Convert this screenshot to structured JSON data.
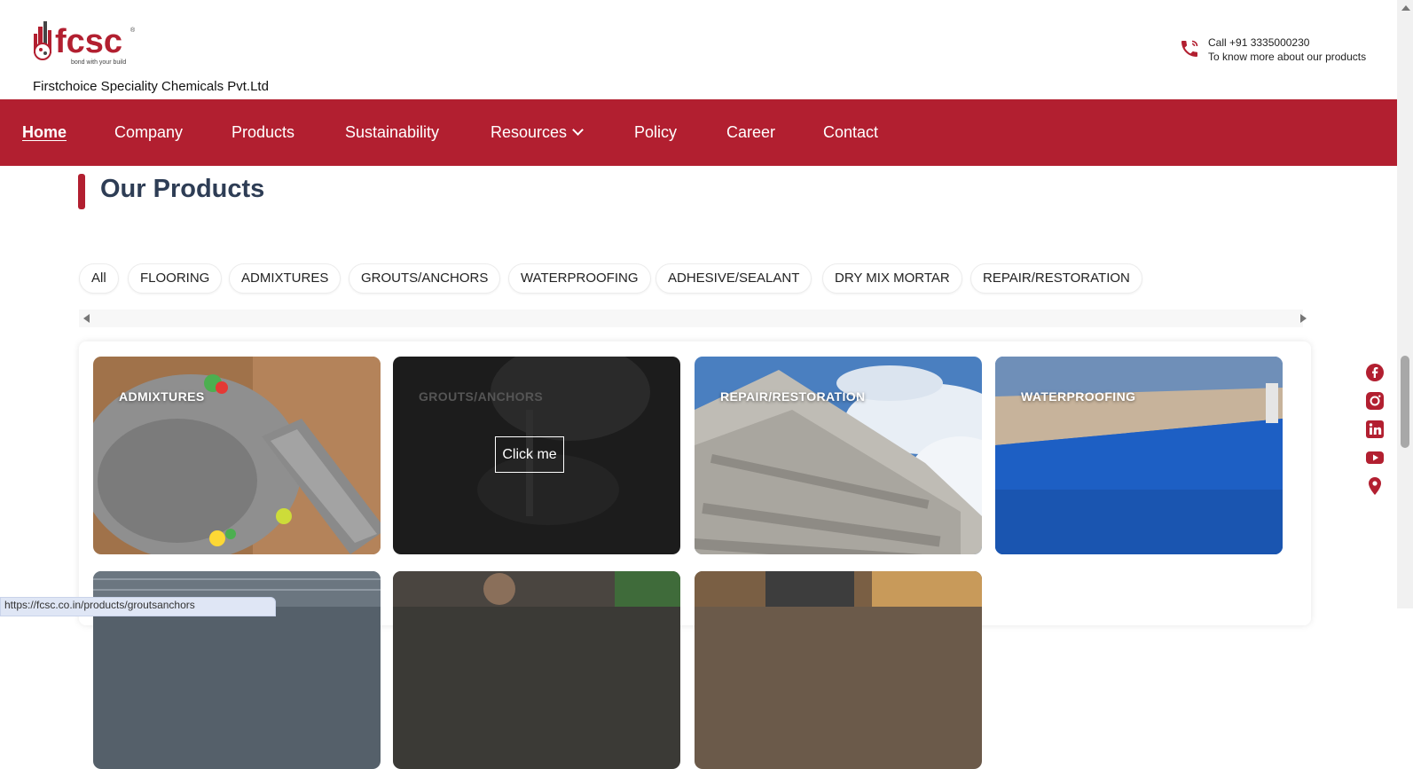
{
  "header": {
    "logo_text": "fcsc",
    "logo_tagline": "bond with your build",
    "company_name": "Firstchoice Speciality Chemicals Pvt.Ltd",
    "contact_line1": "Call +91 3335000230",
    "contact_line2": "To know more about our products",
    "icon": "phone-icon"
  },
  "nav": {
    "items": [
      {
        "label": "Home",
        "active": true
      },
      {
        "label": "Company"
      },
      {
        "label": "Products"
      },
      {
        "label": "Sustainability"
      },
      {
        "label": "Resources",
        "has_dropdown": true
      },
      {
        "label": "Policy"
      },
      {
        "label": "Career"
      },
      {
        "label": "Contact"
      }
    ]
  },
  "section": {
    "title": "Our Products"
  },
  "filters": [
    "All",
    "FLOORING",
    "ADMIXTURES",
    "GROUTS/ANCHORS",
    "WATERPROOFING",
    "ADHESIVE/SEALANT",
    "DRY MIX MORTAR",
    "REPAIR/RESTORATION"
  ],
  "cards": [
    {
      "label": "ADMIXTURES"
    },
    {
      "label": "GROUTS/ANCHORS",
      "hover_button": "Click me"
    },
    {
      "label": "REPAIR/RESTORATION"
    },
    {
      "label": "WATERPROOFING"
    }
  ],
  "social_icons": [
    "facebook-icon",
    "instagram-icon",
    "linkedin-icon",
    "youtube-icon",
    "location-pin-icon"
  ],
  "status_bar": {
    "url": "https://fcsc.co.in/products/groutsanchors"
  },
  "colors": {
    "brand_red": "#b21f30",
    "title_navy": "#2e3d55"
  }
}
